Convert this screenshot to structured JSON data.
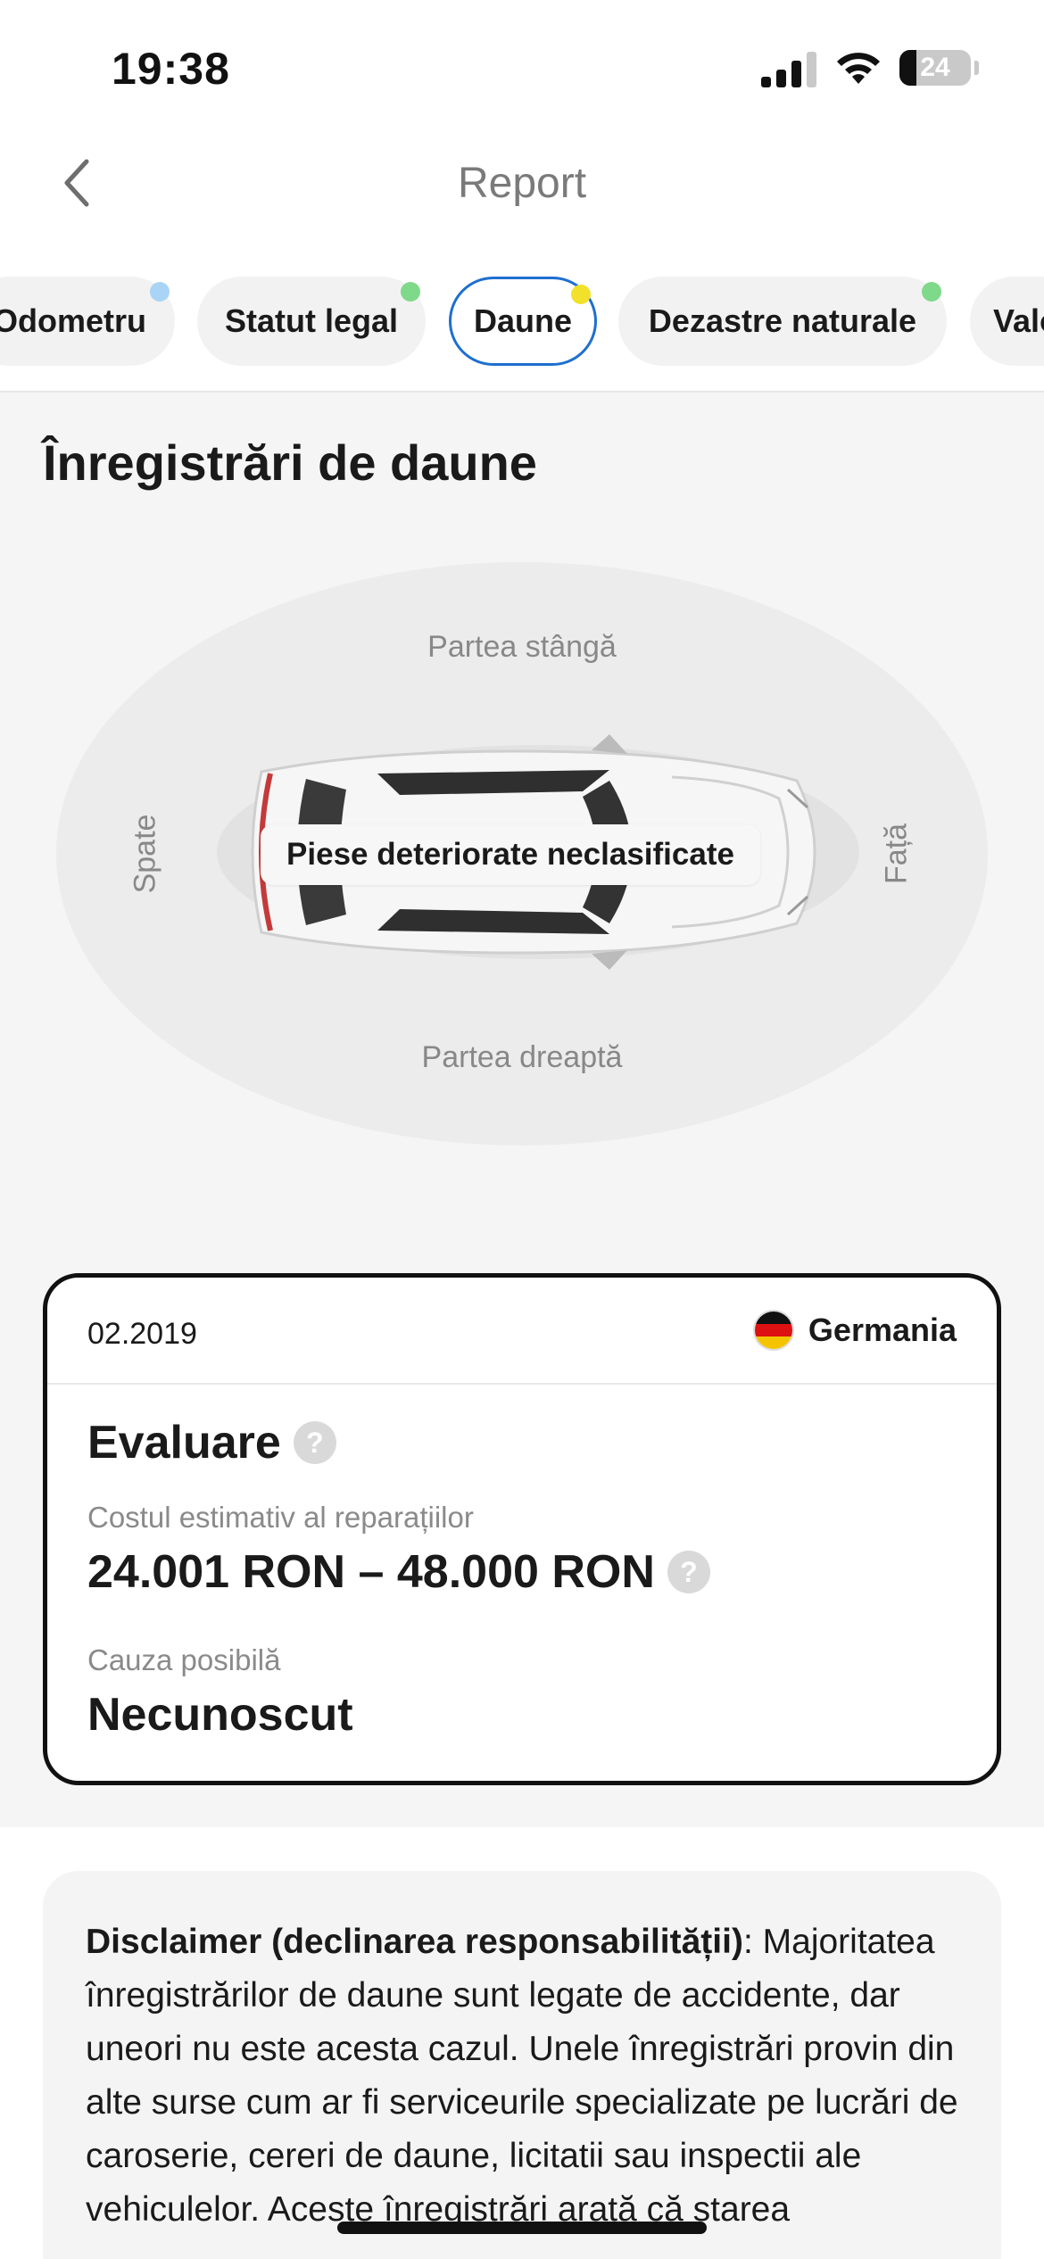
{
  "status_bar": {
    "time": "19:38",
    "battery": "24",
    "battery_level_percent": 24
  },
  "header": {
    "title": "Report",
    "back_icon": "chevron-left-icon"
  },
  "tabs": [
    {
      "label": "Odometru",
      "dot_color": "#a9d4f5",
      "active": false
    },
    {
      "label": "Statut legal",
      "dot_color": "#7fd98a",
      "active": false
    },
    {
      "label": "Daune",
      "dot_color": "#f2e12a",
      "active": true
    },
    {
      "label": "Dezastre naturale",
      "dot_color": "#7fd98a",
      "active": false
    },
    {
      "label": "Valoare",
      "dot_color": "",
      "active": false
    }
  ],
  "section": {
    "title": "Înregistrări de daune"
  },
  "diagram": {
    "left": "Partea stângă",
    "right": "Partea dreaptă",
    "rear": "Spate",
    "front": "Față",
    "damage_label": "Piese deteriorate neclasificate"
  },
  "record": {
    "date": "02.2019",
    "country": "Germania",
    "flag_colors": [
      "#111111",
      "#dd1111",
      "#f5c400"
    ],
    "evaluation_title": "Evaluare",
    "cost_label": "Costul estimativ al reparațiilor",
    "cost_value": "24.001 RON – 48.000 RON",
    "cause_label": "Cauza posibilă",
    "cause_value": "Necunoscut",
    "help_glyph": "?"
  },
  "disclaimer": {
    "title": "Disclaimer (declinarea responsabilității)",
    "separator": ":",
    "body": "Majoritatea înregistrărilor de daune sunt legate de accidente, dar uneori nu este acesta cazul. Unele înregistrări provin din alte surse cum ar fi serviceurile specializate pe lucrări de caroserie, cereri de daune, licitatii sau inspectii ale vehiculelor. Aceste înregistrări arată că starea"
  },
  "colors": {
    "accent": "#1e6fd0",
    "label_gray": "#8a8a8a"
  }
}
